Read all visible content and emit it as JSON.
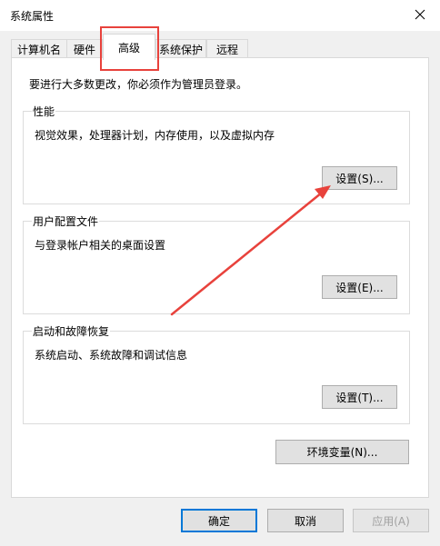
{
  "window": {
    "title": "系统属性"
  },
  "tabs": [
    {
      "label": "计算机名"
    },
    {
      "label": "硬件"
    },
    {
      "label": "高级"
    },
    {
      "label": "系统保护"
    },
    {
      "label": "远程"
    }
  ],
  "intro": "要进行大多数更改，你必须作为管理员登录。",
  "groups": {
    "performance": {
      "label": "性能",
      "description": "视觉效果，处理器计划，内存使用，以及虚拟内存",
      "button": "设置(S)..."
    },
    "profiles": {
      "label": "用户配置文件",
      "description": "与登录帐户相关的桌面设置",
      "button": "设置(E)..."
    },
    "startup": {
      "label": "启动和故障恢复",
      "description": "系统启动、系统故障和调试信息",
      "button": "设置(T)..."
    }
  },
  "env_button": "环境变量(N)...",
  "footer": {
    "ok": "确定",
    "cancel": "取消",
    "apply": "应用(A)"
  },
  "annotation_color": "#e8423c"
}
